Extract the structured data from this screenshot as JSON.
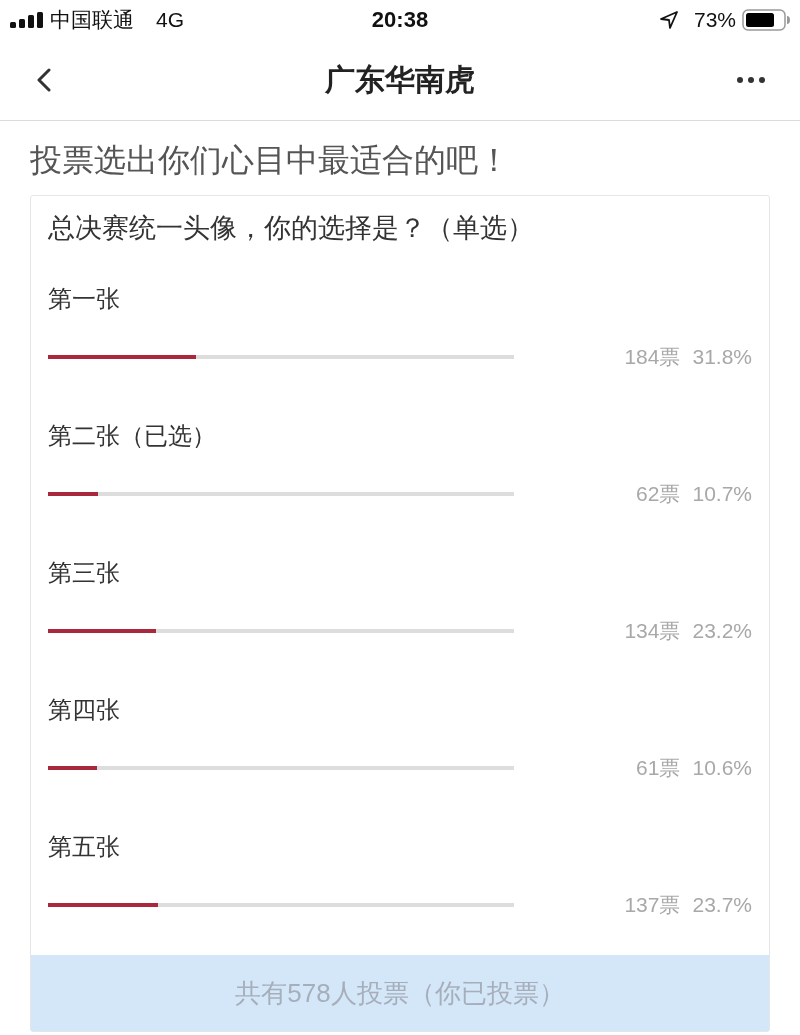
{
  "status_bar": {
    "carrier": "中国联通",
    "network": "4G",
    "time": "20:38",
    "battery": "73%"
  },
  "nav_bar": {
    "title": "广东华南虎"
  },
  "heading": "投票选出你们心目中最适合的吧！",
  "poll": {
    "question": "总决赛统一头像，你的选择是？（单选）",
    "options": [
      {
        "label": "第一张",
        "level": 0.318,
        "votes": "184票",
        "percent": "31.8%"
      },
      {
        "label": "第二张（已选）",
        "level": 0.107,
        "votes": "62票",
        "percent": "10.7%"
      },
      {
        "label": "第三张",
        "level": 0.232,
        "votes": "134票",
        "percent": "23.2%"
      },
      {
        "label": "第四张",
        "level": 0.106,
        "votes": "61票",
        "percent": "10.6%"
      },
      {
        "label": "第五张",
        "level": 0.237,
        "votes": "137票",
        "percent": "23.7%"
      }
    ],
    "footer": "共有578人投票（你已投票）"
  }
}
